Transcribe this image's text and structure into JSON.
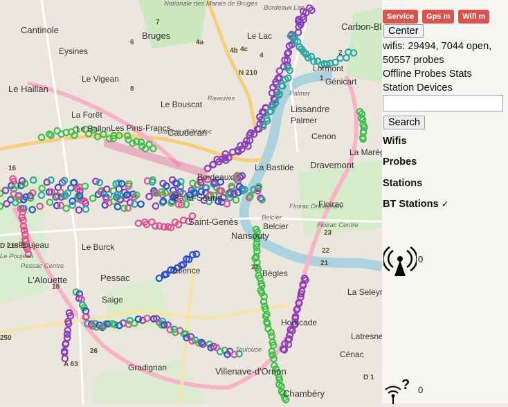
{
  "map": {
    "places": [
      {
        "name": "Cantinole"
      },
      {
        "name": "Eysines"
      },
      {
        "name": "Le Vigean"
      },
      {
        "name": "Le Haillan"
      },
      {
        "name": "La Forêt"
      },
      {
        "name": "Le Ballon"
      },
      {
        "name": "Bruges"
      },
      {
        "name": "Le Lac"
      },
      {
        "name": "Le Bouscat"
      },
      {
        "name": "Caudéran"
      },
      {
        "name": "Les Pins-Francs"
      },
      {
        "name": "Lormont"
      },
      {
        "name": "Lissandre"
      },
      {
        "name": "Palmer"
      },
      {
        "name": "Génicart"
      },
      {
        "name": "Carbon-Blanc"
      },
      {
        "name": "Cenon"
      },
      {
        "name": "La Marègue"
      },
      {
        "name": "Dravemont"
      },
      {
        "name": "La Bastide"
      },
      {
        "name": "Floirac"
      },
      {
        "name": "Pessac"
      },
      {
        "name": "Le Burck"
      },
      {
        "name": "Talence"
      },
      {
        "name": "Saint-Genès"
      },
      {
        "name": "Bègles"
      },
      {
        "name": "Saige"
      },
      {
        "name": "L'Alouette"
      },
      {
        "name": "Gradignan"
      },
      {
        "name": "Hourcade"
      },
      {
        "name": "Villenave-d'Ornon"
      },
      {
        "name": "Latresne"
      },
      {
        "name": "Cénac"
      },
      {
        "name": "Chambéry"
      },
      {
        "name": "Bordeaux"
      },
      {
        "name": "Belcier"
      },
      {
        "name": "Nansouty"
      },
      {
        "name": "Le Poujeau"
      },
      {
        "name": "La Seleyre"
      },
      {
        "name": "Saint-Seurin"
      }
    ],
    "road_labels": [
      "N 210",
      "4a",
      "4b",
      "4c",
      "4",
      "2",
      "1",
      "23",
      "22",
      "21",
      "21",
      "26",
      "D 1",
      "A 63",
      "250",
      "D 213 E",
      "18",
      "16",
      "7",
      "6",
      "8"
    ],
    "small_labels": [
      "Barrière du Médoc",
      "Floirac Centre",
      "Pessac Centre",
      "Toulouse",
      "Bordeaux Lac",
      "Nationale des Marais de Bruges",
      "Palmer",
      "Le Poujeau",
      "Floirac Dravemont",
      "Belcier",
      "Ravezies"
    ]
  },
  "toolbar": {
    "service_label": "Service",
    "gps_label": "Gps m",
    "wifi_label": "Wifi m",
    "center_label": "Center"
  },
  "stats": {
    "summary_line1": "wifis: 29494, 7044 open,",
    "summary_line2": "50557 probes",
    "offline_link": "Offline Probes Stats",
    "station_link": "Station Devices"
  },
  "search": {
    "placeholder": "",
    "button_label": "Search"
  },
  "layers": {
    "wifis": "Wifis",
    "probes": "Probes",
    "stations": "Stations",
    "bt_stations": "BT Stations",
    "bt_checkmark": "✓"
  },
  "legend": {
    "antenna_count": "0",
    "unknown_count": "0"
  },
  "colors": {
    "badge": "#d9534f",
    "track_green": "#3fbf4a",
    "track_blue": "#2a4fd6",
    "track_purple": "#8a3fb8",
    "track_pink": "#e0508f",
    "track_teal": "#2ba6a0"
  }
}
